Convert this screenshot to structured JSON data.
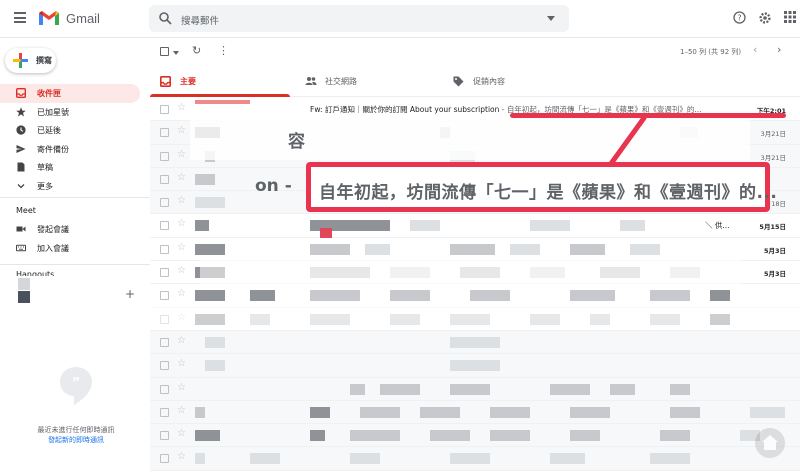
{
  "header": {
    "brand": "Gmail",
    "search_placeholder": "搜尋郵件",
    "icons": [
      "menu-icon",
      "gmail-logo",
      "search-icon",
      "help-icon",
      "settings-icon",
      "apps-icon"
    ]
  },
  "sidebar": {
    "compose_label": "撰寫",
    "items": [
      {
        "label": "收件匣",
        "icon": "inbox-icon",
        "active": true
      },
      {
        "label": "已加星號",
        "icon": "star-icon"
      },
      {
        "label": "已延後",
        "icon": "clock-icon"
      },
      {
        "label": "寄件備份",
        "icon": "send-icon"
      },
      {
        "label": "草稿",
        "icon": "draft-icon"
      },
      {
        "label": "更多",
        "icon": "chevron-down-icon"
      }
    ],
    "meet_title": "Meet",
    "meet_items": [
      {
        "label": "發起會議",
        "icon": "video-icon"
      },
      {
        "label": "加入會議",
        "icon": "keyboard-icon"
      }
    ],
    "hangouts_title": "Hangouts",
    "hangouts_empty": "最近未進行任何即時通訊",
    "hangouts_start": "發起新的即時通訊"
  },
  "toolbar": {
    "pager_text": "1–50 列 (共 92 列)"
  },
  "tabs": [
    {
      "label": "主要",
      "icon": "inbox-tab-icon",
      "active": true
    },
    {
      "label": "社交網路",
      "icon": "people-icon"
    },
    {
      "label": "促銷內容",
      "icon": "tag-icon"
    }
  ],
  "emails": {
    "first": {
      "subject": "Fw: 訂戶通知｜關於你的訂閱 About your subscription",
      "snippet": " - 自年初起，坊間流傳「七一」是《蘋果》和《壹週刊》的...",
      "date": "下午2:01"
    },
    "dates": [
      "",
      "3月21日",
      "3月21日",
      "",
      "3月18日",
      "5月15日",
      "5月3日",
      "5月3日",
      "",
      "",
      "",
      "",
      "",
      "",
      "",
      ""
    ],
    "partial_dates": [
      "容",
      "",
      "",
      "",
      "",
      "＼ 供...",
      "",
      "",
      "",
      "",
      "",
      "",
      "",
      "",
      ""
    ]
  },
  "annotation": {
    "callout_text": "自年初起，坊間流傳「七一」是《蘋果》和《壹週刊》的...",
    "callout_prefix": "on -",
    "color": "#e8344e"
  },
  "colors": {
    "accent": "#d93025",
    "active_bg": "#fce8e6",
    "link": "#1a73e8"
  }
}
